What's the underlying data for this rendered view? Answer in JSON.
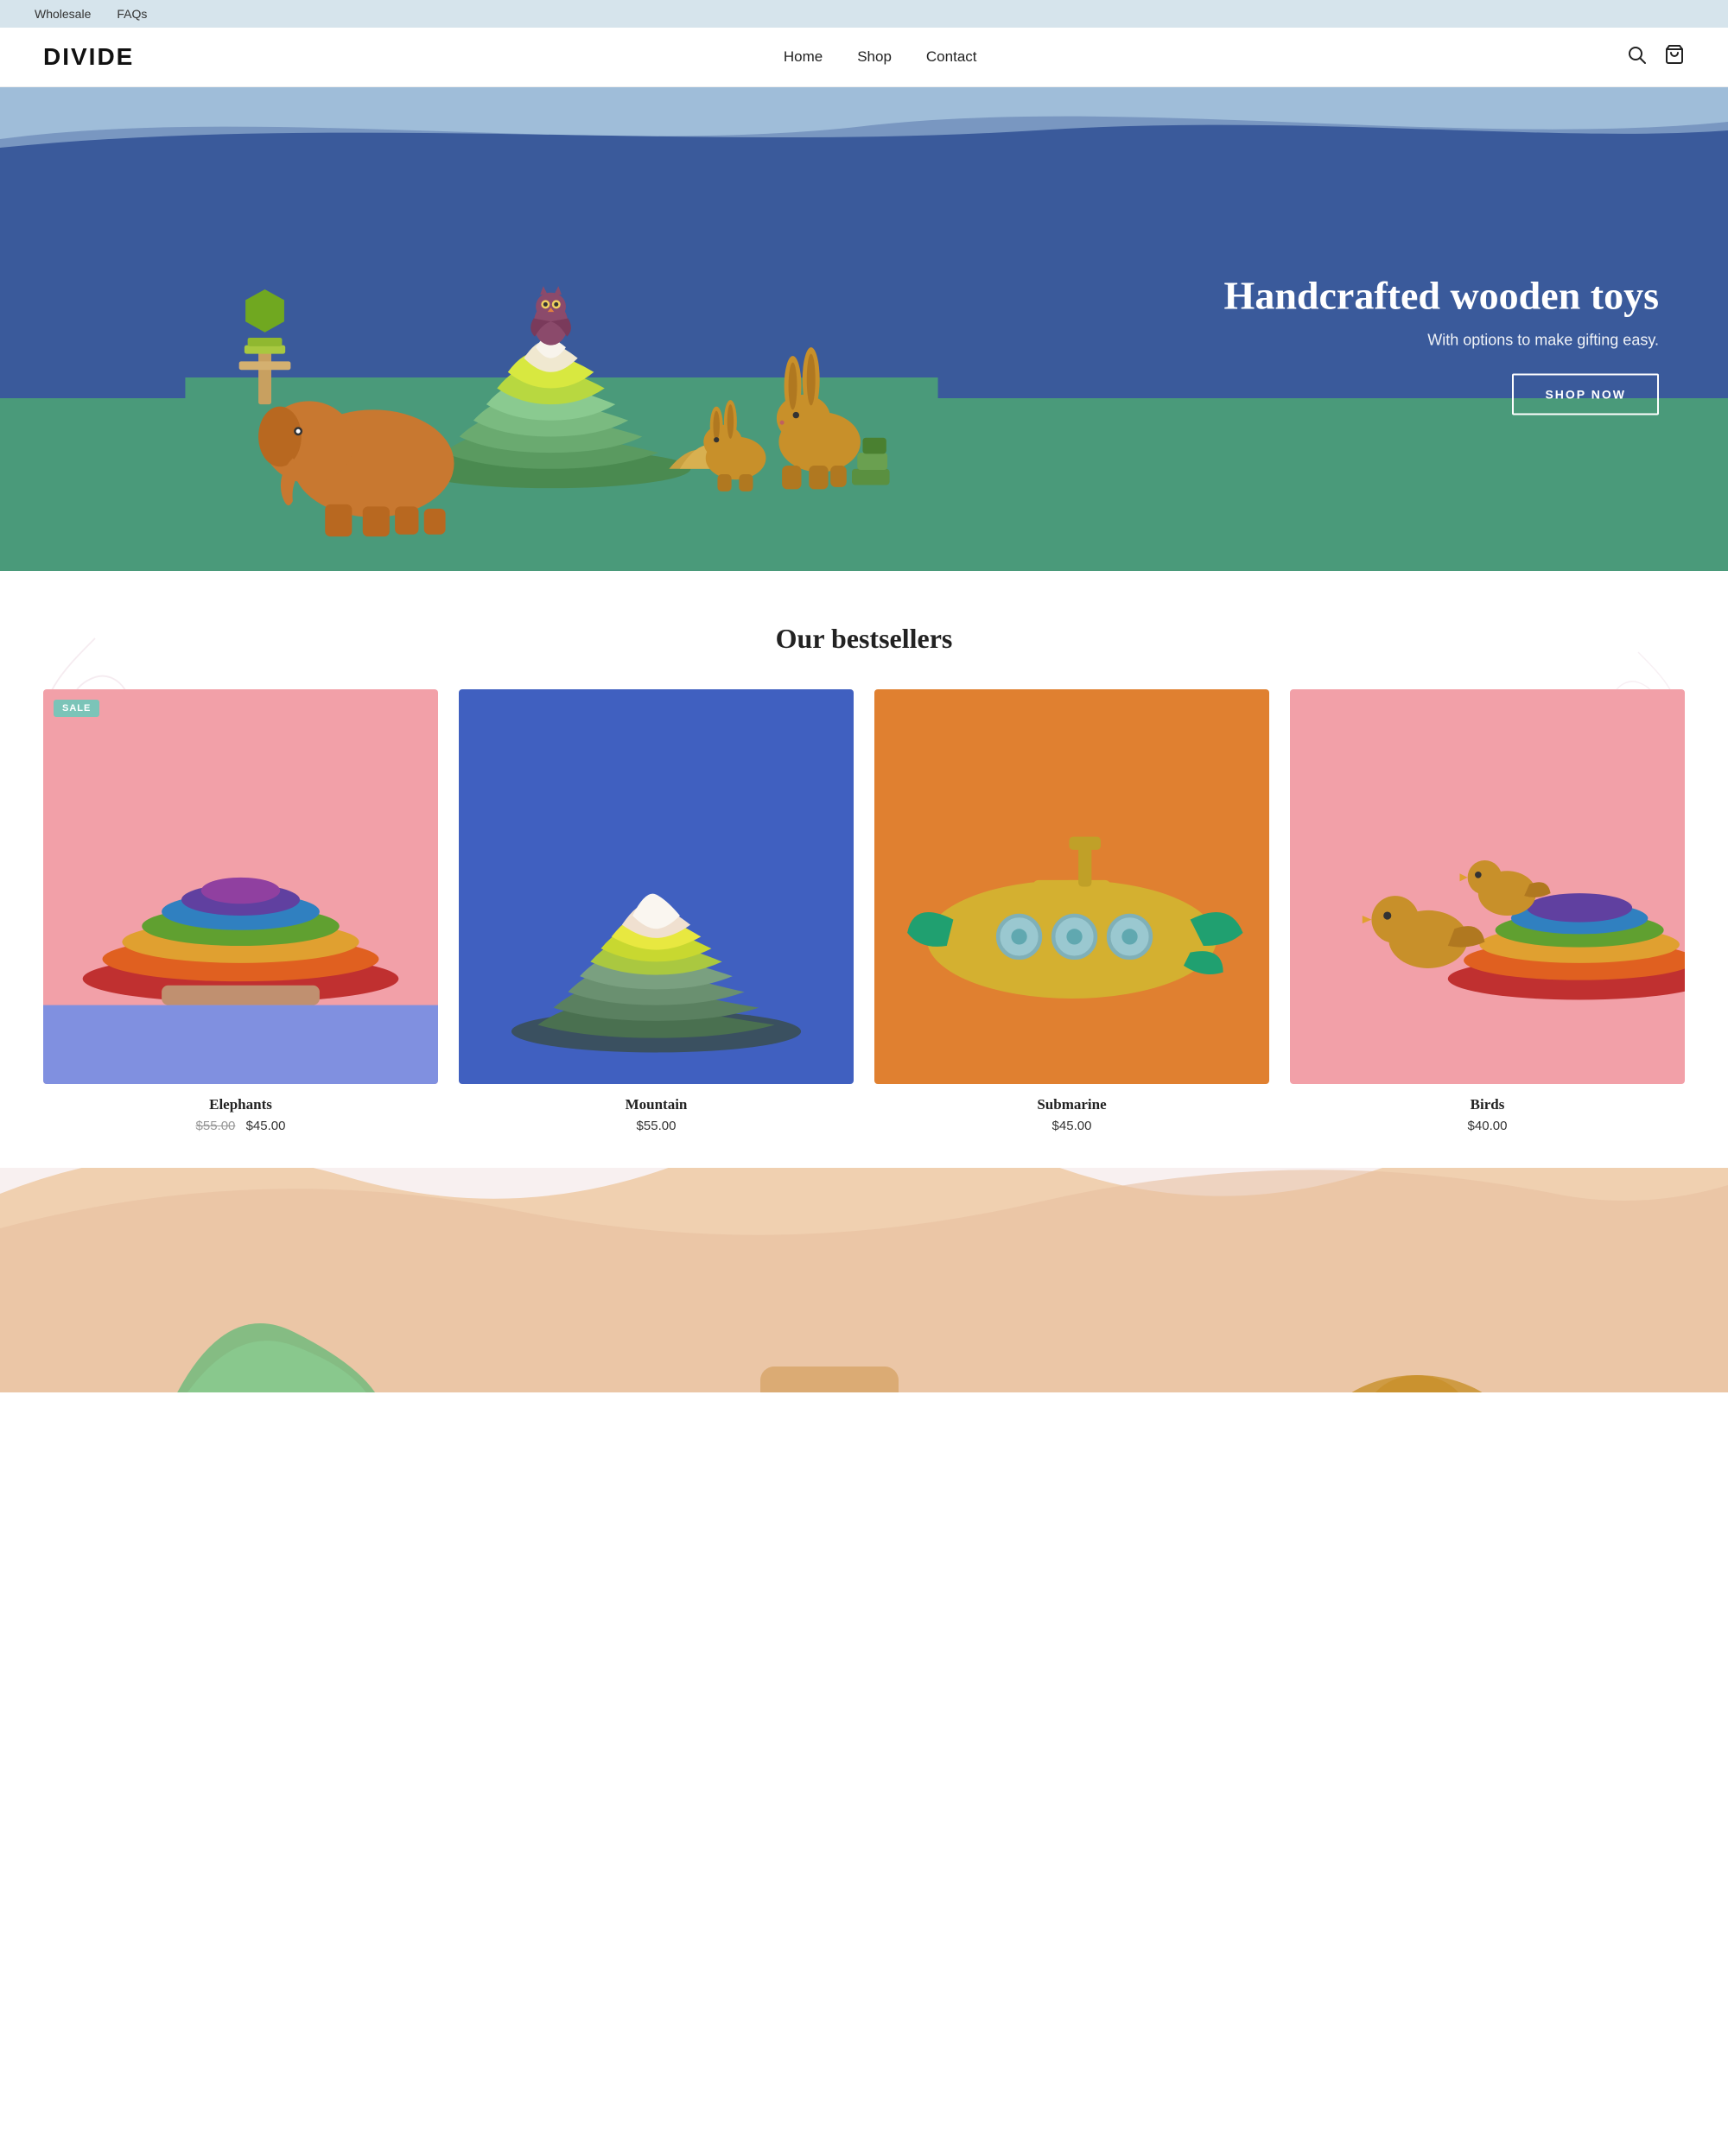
{
  "topbar": {
    "links": [
      "Wholesale",
      "FAQs"
    ]
  },
  "header": {
    "logo": "DIVIDE",
    "nav": [
      "Home",
      "Shop",
      "Contact"
    ],
    "icons": {
      "search": "🔍",
      "cart": "🛒"
    }
  },
  "hero": {
    "title": "Handcrafted wooden toys",
    "subtitle": "With options to make gifting easy.",
    "button_label": "SHOP NOW"
  },
  "bestsellers": {
    "section_title": "Our bestsellers",
    "products": [
      {
        "name": "Elephants",
        "price_original": "$55.00",
        "price_sale": "$45.00",
        "on_sale": true,
        "bg_color": "#f2a0a8",
        "accent_color": "#e06060"
      },
      {
        "name": "Mountain",
        "price_original": null,
        "price_sale": "$55.00",
        "on_sale": false,
        "bg_color": "#4060c0",
        "accent_color": "#5a80d0"
      },
      {
        "name": "Submarine",
        "price_original": null,
        "price_sale": "$45.00",
        "on_sale": false,
        "bg_color": "#e08030",
        "accent_color": "#c06020"
      },
      {
        "name": "Birds",
        "price_original": null,
        "price_sale": "$40.00",
        "on_sale": false,
        "bg_color": "#f2a0a8",
        "accent_color": "#e06060"
      }
    ],
    "sale_badge_label": "SALE"
  }
}
